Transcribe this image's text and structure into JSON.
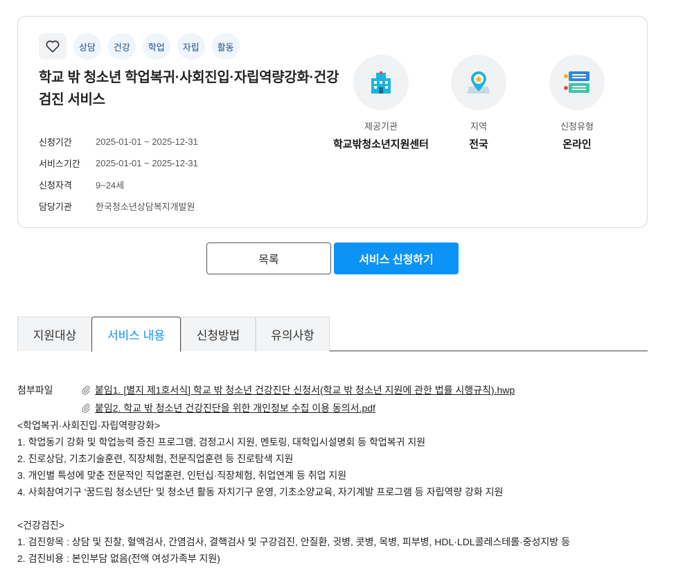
{
  "tags": [
    "상담",
    "건강",
    "학업",
    "자립",
    "활동"
  ],
  "title": "학교 밖 청소년 학업복귀·사회진입·자립역량강화·건강검진 서비스",
  "info": [
    {
      "label": "신청기간",
      "value": "2025-01-01 ~ 2025-12-31"
    },
    {
      "label": "서비스기간",
      "value": "2025-01-01 ~ 2025-12-31"
    },
    {
      "label": "신청자격",
      "value": "9~24세"
    },
    {
      "label": "담당기관",
      "value": "한국청소년상담복지개발원"
    }
  ],
  "features": [
    {
      "icon": "building-icon",
      "label": "제공기관",
      "value": "학교밖청소년지원센터"
    },
    {
      "icon": "map-pin-icon",
      "label": "지역",
      "value": "전국"
    },
    {
      "icon": "document-list-icon",
      "label": "신청유형",
      "value": "온라인"
    }
  ],
  "buttons": {
    "list": "목록",
    "apply": "서비스 신청하기"
  },
  "tabs": [
    "지원대상",
    "서비스 내용",
    "신청방법",
    "유의사항"
  ],
  "active_tab": "서비스 내용",
  "attachments": {
    "label": "첨부파일",
    "files": [
      "붙임1. [별지 제1호서식] 학교 밖 청소년 건강진단 신청서(학교 밖 청소년 지원에 관한 법률 시행규칙).hwp",
      "붙임2. 학교 밖 청소년 건강진단을 위한 개인정보 수집 이용 동의서.pdf"
    ]
  },
  "content_lines": [
    "<학업복귀·사회진입·자립역량강화>",
    "1. 학업동기 강화 및 학업능력 증진 프로그램, 검정고시 지원, 멘토링, 대학입시설명회 등 학업복귀 지원",
    "2. 진로상담, 기초기술훈련, 직장체험, 전문직업훈련 등 진로탐색 지원",
    "3. 개인별 특성에 맞춘 전문적인 직업훈련, 인턴십·직장체험, 취업연계 등 취업 지원",
    "4. 사회참여기구 '꿈드림 청소년단' 및 청소년 활동 자치기구 운영, 기초소양교육, 자기계발 프로그램 등 자립역량 강화 지원",
    "",
    "<건강검진>",
    "1. 검진항목 : 상담 및 진찰, 혈액검사, 간염검사, 결핵검사 및 구강검진, 안질환, 귓병, 콧병, 목병, 피부병, HDL·LDL콜레스테롤·중성지방 등",
    "2. 검진비용 : 본인부담 없음(전액 여성가족부 지원)"
  ],
  "colors": {
    "accent": "#0b93f6",
    "tag_bg": "#eef5fc",
    "tag_text": "#1f4f82"
  }
}
